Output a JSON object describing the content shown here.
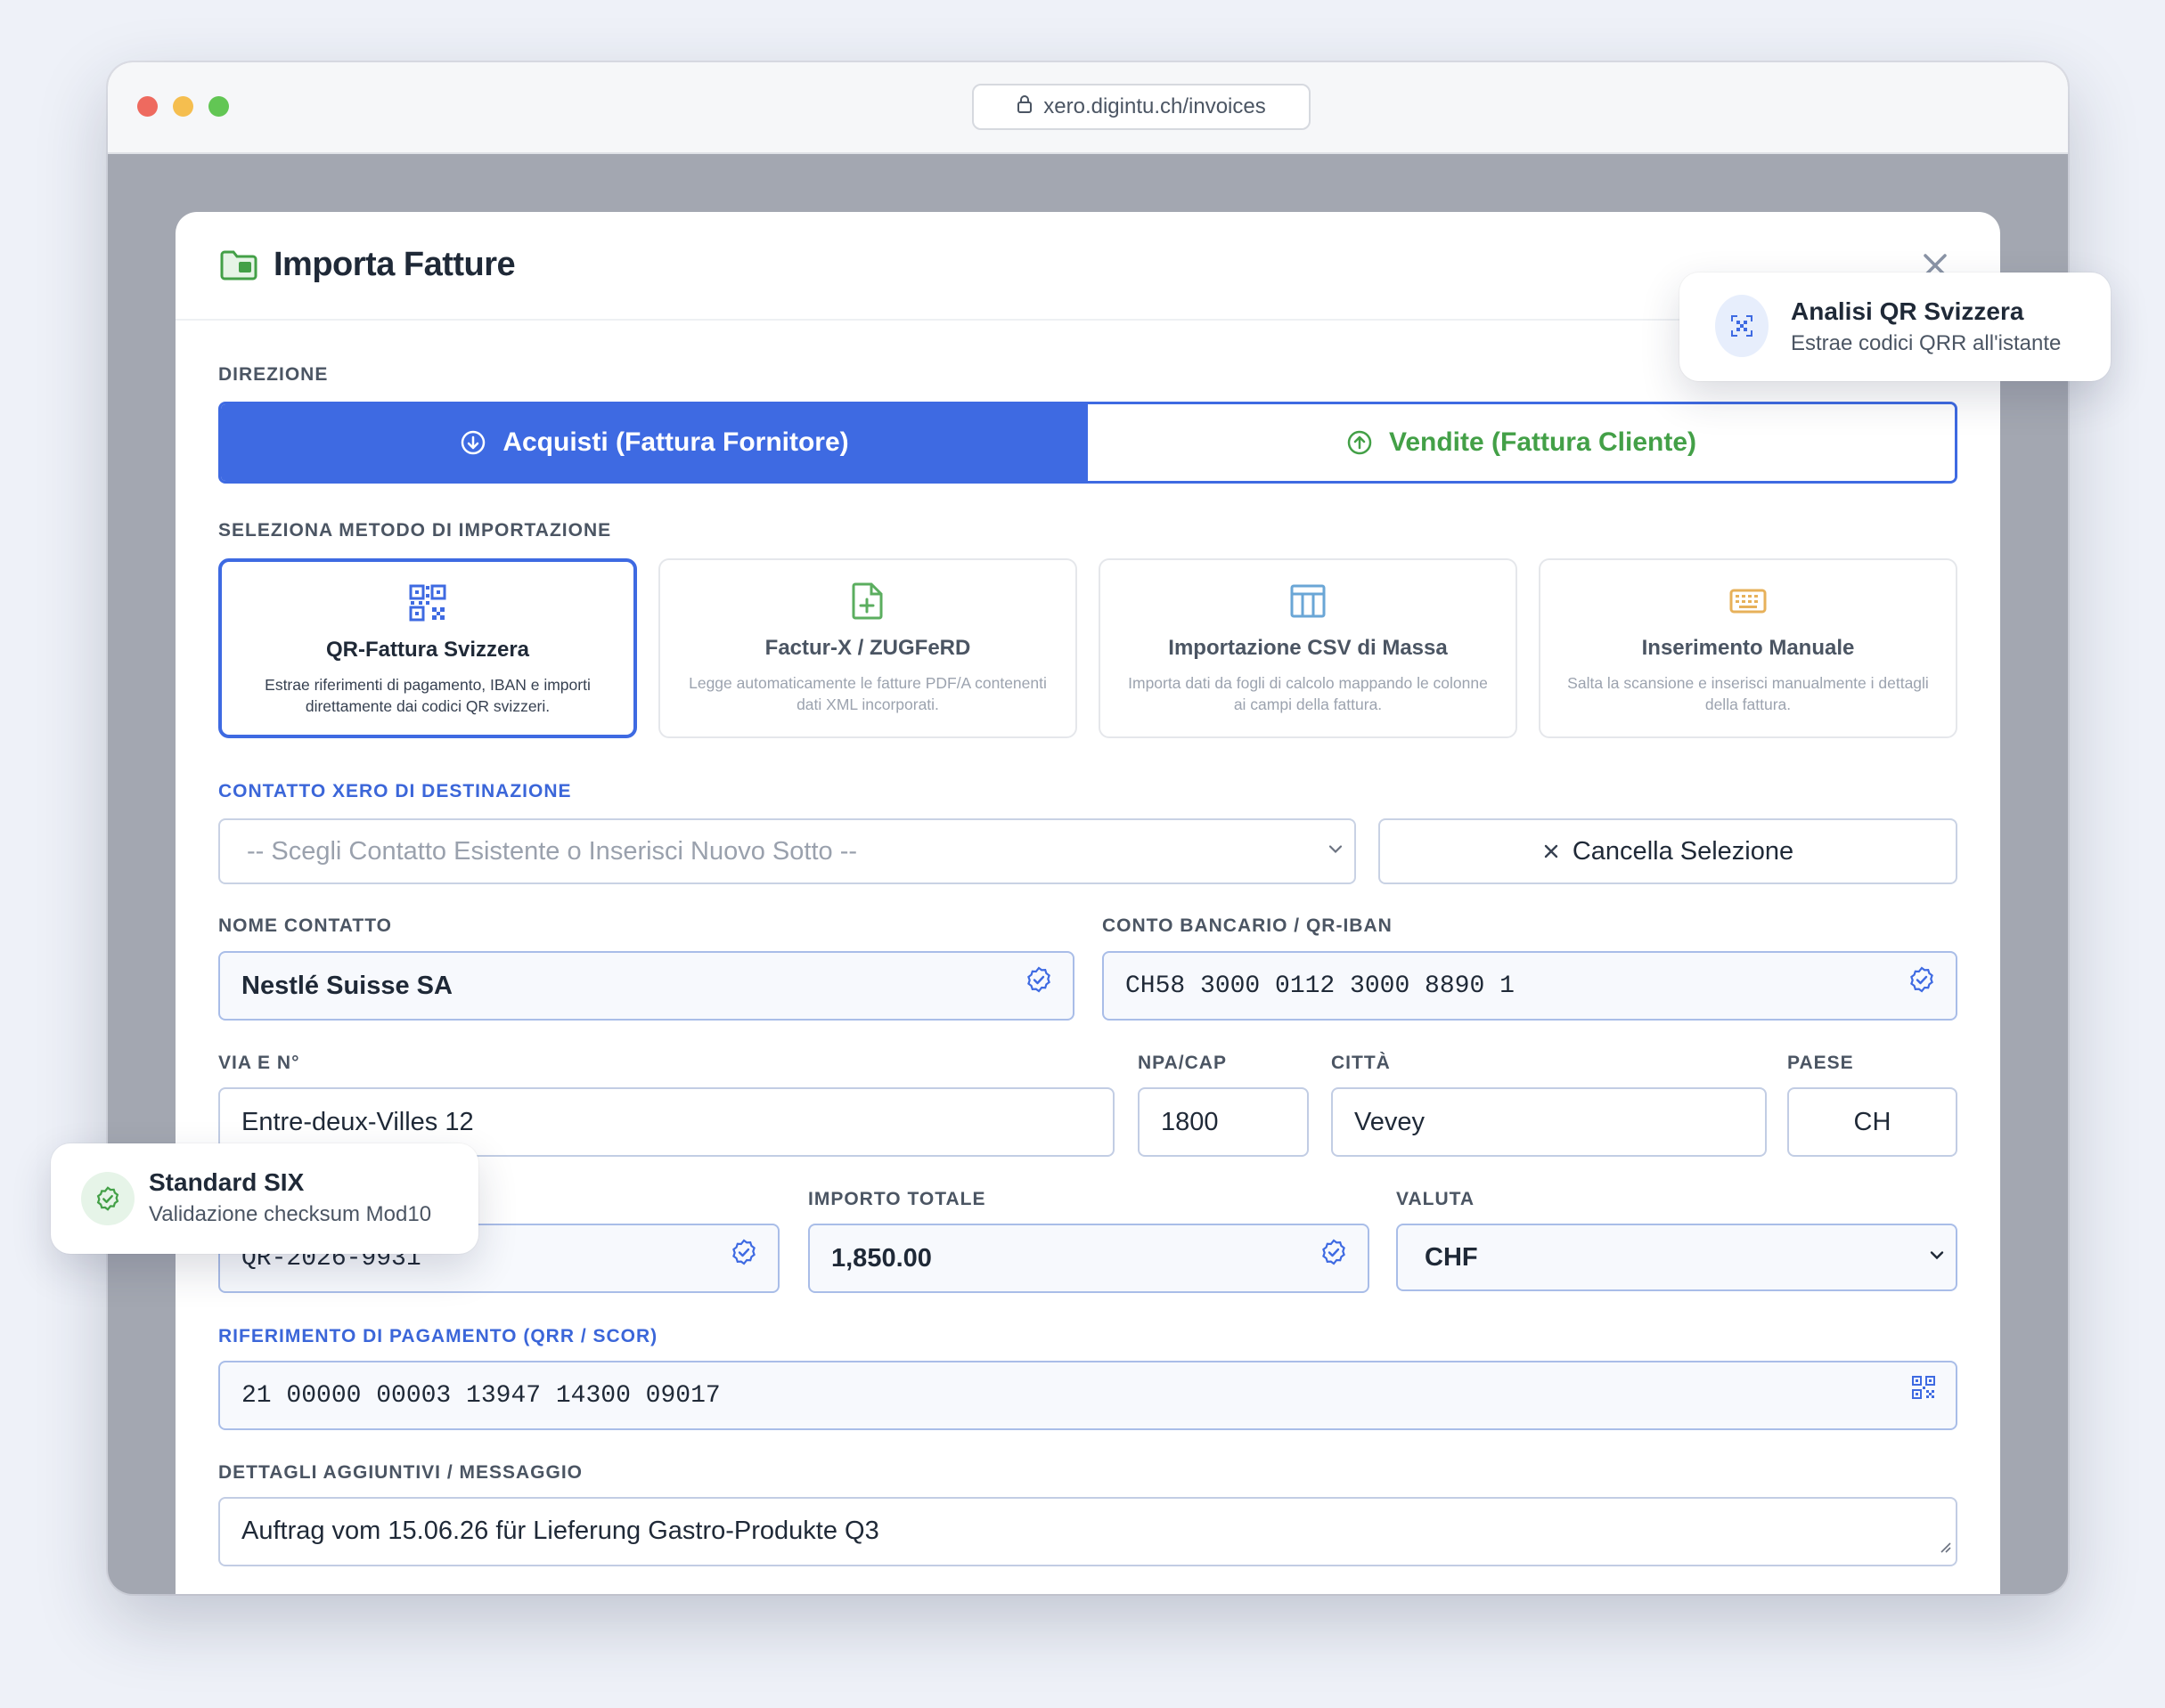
{
  "browser": {
    "url": "xero.digintu.ch/invoices"
  },
  "modal": {
    "title": "Importa Fatture"
  },
  "direction": {
    "label": "DIREZIONE",
    "purchase": "Acquisti (Fattura Fornitore)",
    "sales": "Vendite (Fattura Cliente)",
    "selected": "purchase"
  },
  "methods": {
    "label": "SELEZIONA METODO DI IMPORTAZIONE",
    "items": [
      {
        "title": "QR-Fattura Svizzera",
        "desc": "Estrae riferimenti di pagamento, IBAN e importi direttamente dai codici QR svizzeri.",
        "icon": "qr-code-icon"
      },
      {
        "title": "Factur-X / ZUGFeRD",
        "desc": "Legge automaticamente le fatture PDF/A contenenti dati XML incorporati.",
        "icon": "file-plus-icon"
      },
      {
        "title": "Importazione CSV di Massa",
        "desc": "Importa dati da fogli di calcolo mappando le colonne ai campi della fattura.",
        "icon": "table-icon"
      },
      {
        "title": "Inserimento Manuale",
        "desc": "Salta la scansione e inserisci manualmente i dettagli della fattura.",
        "icon": "keyboard-icon"
      }
    ]
  },
  "contact": {
    "label": "CONTATTO XERO DI DESTINAZIONE",
    "placeholder": "-- Scegli Contatto Esistente o Inserisci Nuovo Sotto --",
    "clear_button": "Cancella Selezione"
  },
  "fields": {
    "name_label": "NOME CONTATTO",
    "name_value": "Nestlé Suisse SA",
    "iban_label": "CONTO BANCARIO / QR-IBAN",
    "iban_value": "CH58 3000 0112 3000 8890 1",
    "street_label": "VIA E N°",
    "street_value": "Entre-deux-Villes 12",
    "zip_label": "NPA/CAP",
    "zip_value": "1800",
    "city_label": "CITTÀ",
    "city_value": "Vevey",
    "country_label": "PAESE",
    "country_value": "CH",
    "invoice_value": "QR-2026-9931",
    "amount_label": "IMPORTO TOTALE",
    "amount_value": "1,850.00",
    "currency_label": "VALUTA",
    "currency_value": "CHF",
    "reference_label": "RIFERIMENTO DI PAGAMENTO (QRR / SCOR)",
    "reference_value": "21 00000 00003 13947 14300 09017",
    "details_label": "DETTAGLI AGGIUNTIVI / MESSAGGIO",
    "details_value": "Auftrag vom 15.06.26 für Lieferung Gastro-Produkte Q3"
  },
  "toasts": {
    "qr": {
      "title": "Analisi QR Svizzera",
      "sub": "Estrae codici QRR all'istante"
    },
    "six": {
      "title": "Standard SIX",
      "sub": "Validazione checksum Mod10"
    }
  },
  "colors": {
    "primary": "#3e6ae2",
    "success": "#43a047",
    "window_backdrop": "#a3a7b1"
  }
}
